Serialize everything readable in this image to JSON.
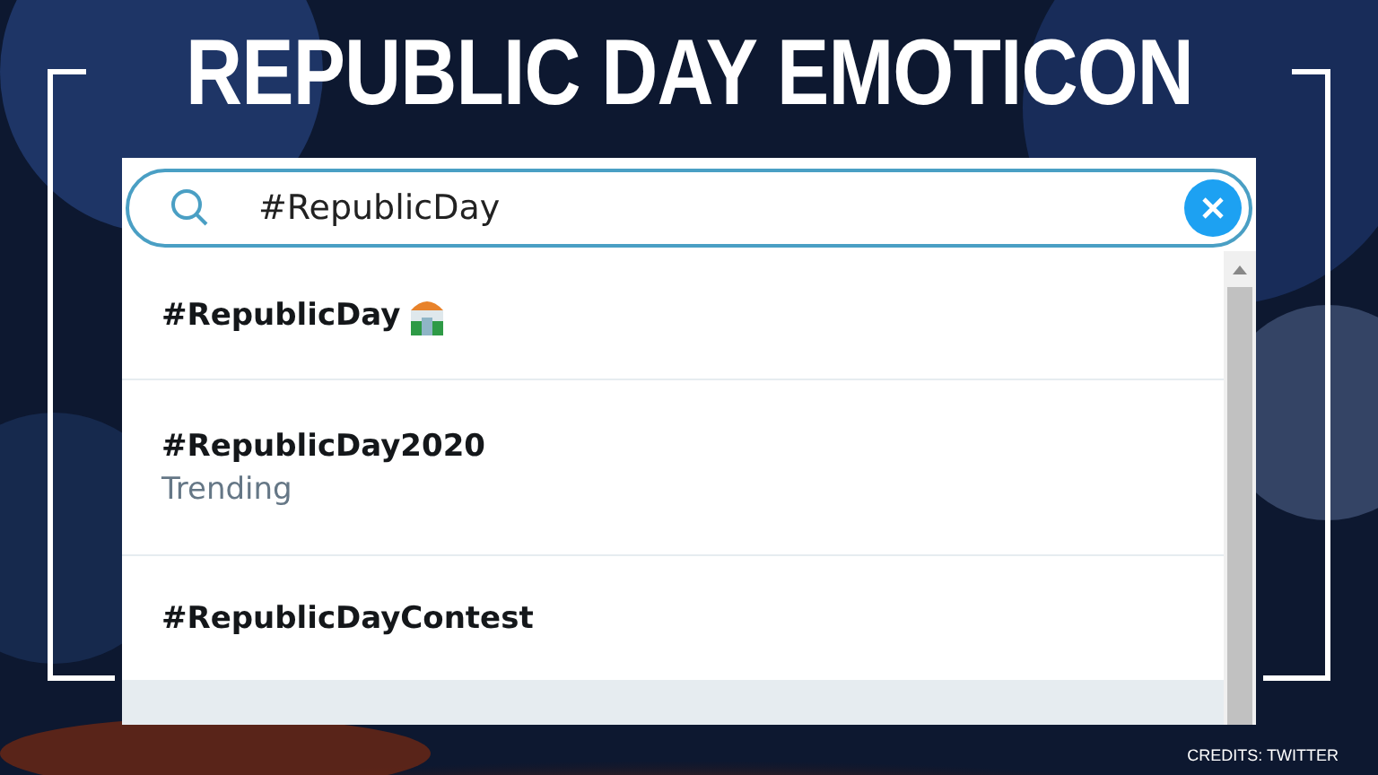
{
  "headline": "REPUBLIC DAY EMOTICON",
  "search": {
    "value": "#RepublicDay"
  },
  "suggestions": [
    {
      "kind": "emoji",
      "tag": "#RepublicDay"
    },
    {
      "kind": "trend",
      "tag": "#RepublicDay2020",
      "subtitle": "Trending"
    },
    {
      "kind": "plain",
      "tag": "#RepublicDayContest"
    }
  ],
  "credits": "CREDITS: TWITTER"
}
